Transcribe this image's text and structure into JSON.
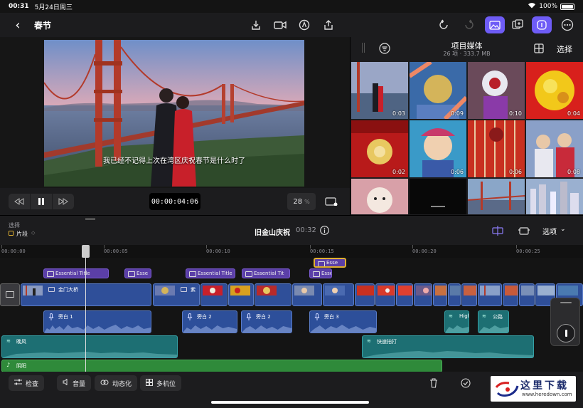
{
  "status_bar": {
    "time": "00:31",
    "date": "5月24日周三",
    "battery": "100%",
    "battery_level": 1.0
  },
  "top_bar": {
    "title": "春节"
  },
  "viewer": {
    "subtitle": "我已经不记得上次在湾区庆祝春节是什么时了",
    "timecode": "00:00:04:06",
    "zoom": "28",
    "zoom_unit": "%"
  },
  "browser": {
    "title": "项目媒体",
    "meta": "26 项 · 333.7 MB",
    "select_label": "选择",
    "durations": [
      "0:03",
      "0:09",
      "0:10",
      "0:04",
      "0:02",
      "0:06",
      "0:06",
      "0:08",
      "",
      "",
      "",
      ""
    ]
  },
  "timeline": {
    "select_label": "选择",
    "clip_mode": "片段",
    "project_name": "旧金山庆祝",
    "project_duration": "00:32",
    "options_label": "选项",
    "ruler": [
      "00:00:00",
      "00:00:05",
      "00:00:10",
      "00:00:15",
      "00:00:20",
      "00:00:25"
    ],
    "titles": [
      "Essential Title",
      "Esse",
      "Essential Title",
      "Essential Tit",
      "Esse",
      "Esse"
    ],
    "video_labels": [
      "金门大桥",
      "紫"
    ],
    "voiceover": [
      "旁白 1",
      "旁白 2",
      "旁白 2",
      "旁白 3",
      "High",
      "公路"
    ],
    "music": [
      "晚风",
      "快速拍打",
      "阴阳"
    ]
  },
  "bottom_bar": {
    "inspect": "检查",
    "volume": "音量",
    "animate": "动态化",
    "multicam": "多机位"
  },
  "watermark": {
    "text": "这里下载",
    "url": "www.heredown.com"
  }
}
